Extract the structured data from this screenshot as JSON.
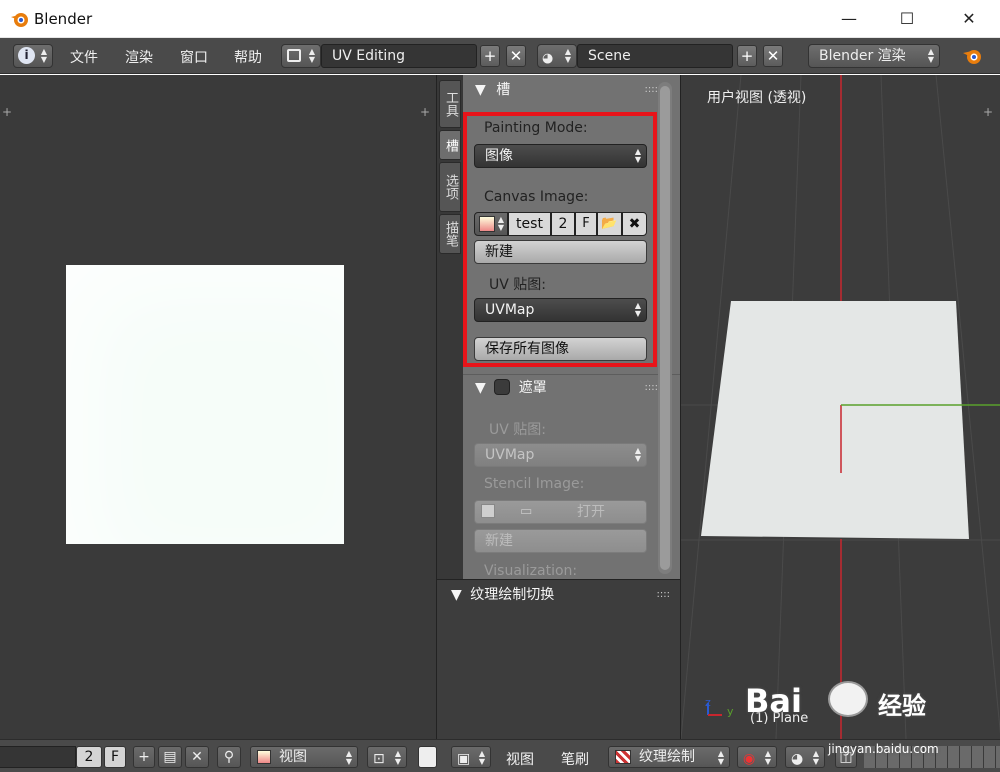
{
  "window": {
    "title": "Blender",
    "minimize_glyph": "—",
    "maximize_glyph": "☐",
    "close_glyph": "✕"
  },
  "header": {
    "menu": [
      "文件",
      "渲染",
      "窗口",
      "帮助"
    ],
    "screen_layout": "UV Editing",
    "scene": "Scene",
    "render_engine": "Blender 渲染"
  },
  "tabs": {
    "tools": "工具",
    "slots": "槽",
    "options": "选项",
    "brush": "描笔"
  },
  "slots_panel": {
    "title": "槽",
    "painting_mode_label": "Painting Mode:",
    "painting_mode_value": "图像",
    "canvas_image_label": "Canvas Image:",
    "canvas_image_name": "test",
    "canvas_image_users": "2",
    "canvas_image_fake": "F",
    "new_button": "新建",
    "uv_map_label": "UV 贴图:",
    "uv_map_value": "UVMap",
    "save_all_button": "保存所有图像"
  },
  "mask_panel": {
    "title": "遮罩",
    "uv_map_label": "UV 贴图:",
    "uv_map_value": "UVMap",
    "stencil_label": "Stencil Image:",
    "open_button": "打开",
    "new_button": "新建",
    "visualization_label": "Visualization:"
  },
  "texture_panel": {
    "title": "纹理绘制切换"
  },
  "viewport": {
    "label": "用户视图 (透视)",
    "object_label": "(1) Plane"
  },
  "bottom": {
    "users": "2",
    "fake": "F",
    "view_left": "视图",
    "view": "视图",
    "brush": "笔刷",
    "mode": "纹理绘制"
  },
  "watermark": {
    "brand": "Bai",
    "brand_cn": "经验",
    "url": "jingyan.baidu.com"
  },
  "colors": {
    "highlight": "#e8141a",
    "x_axis": "#c8262e",
    "y_axis": "#5aa02c",
    "z_axis": "#2a5ad2"
  }
}
